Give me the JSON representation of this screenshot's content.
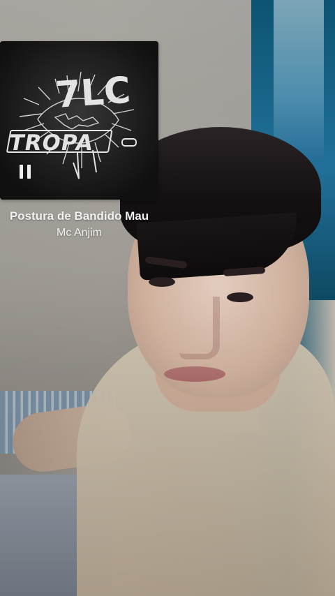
{
  "music_sticker": {
    "cover_art": {
      "logo_text_top": "7LC",
      "logo_text_bottom": "TROPA"
    },
    "song_title": "Postura de Bandido Mau",
    "artist_name": "Mc Anjim",
    "playback_state": "paused"
  },
  "photo": {
    "subject": "selfie"
  },
  "colors": {
    "cover_background": "#111111",
    "text": "#ffffff",
    "wall": "#a9a59e",
    "door": "#1f6f93",
    "shirt": "#d3c2ab"
  },
  "icons": {
    "pause": "pause-icon"
  }
}
